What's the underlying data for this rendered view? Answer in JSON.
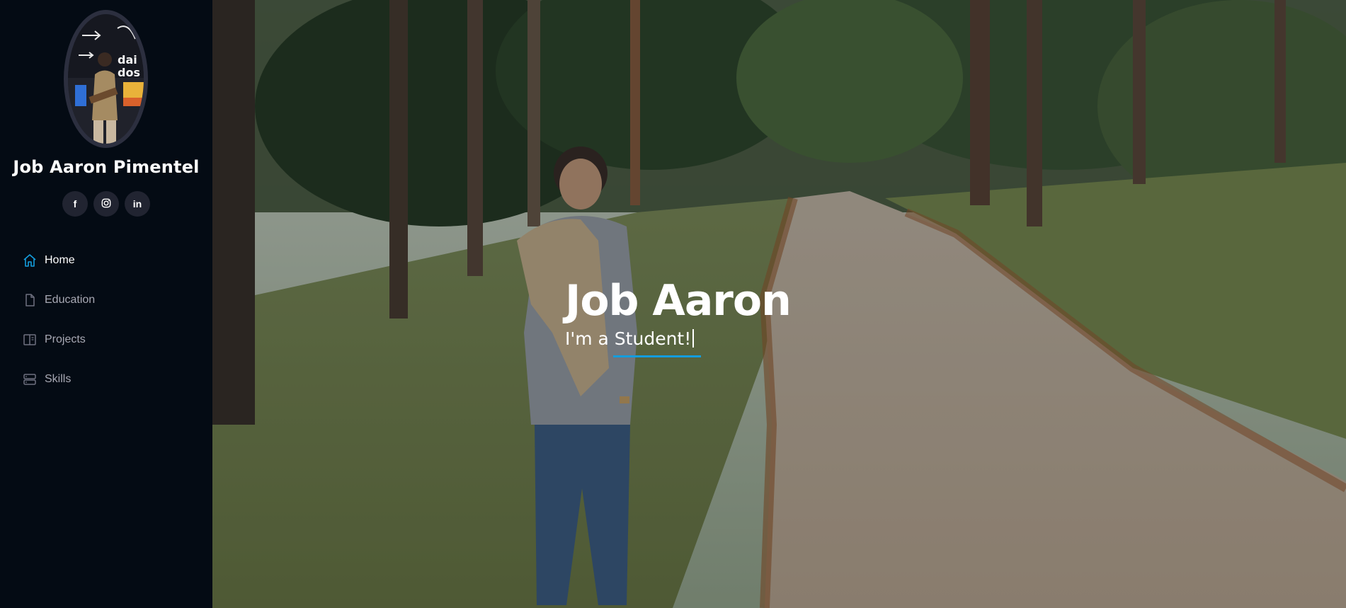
{
  "profile": {
    "name": "Job Aaron Pimentel",
    "avatar_alt": "avatar"
  },
  "social": {
    "facebook_label": "f",
    "instagram_label": "◎",
    "linkedin_label": "in"
  },
  "nav": {
    "items": [
      {
        "label": "Home",
        "icon": "home-icon",
        "active": true
      },
      {
        "label": "Education",
        "icon": "file-icon",
        "active": false
      },
      {
        "label": "Projects",
        "icon": "book-icon",
        "active": false
      },
      {
        "label": "Skills",
        "icon": "server-icon",
        "active": false
      }
    ]
  },
  "hero": {
    "title": "Job Aaron",
    "subtitle": "I'm a Student!"
  },
  "colors": {
    "sidebar_bg": "#040b14",
    "accent": "#149ddd",
    "social_bg": "#212431",
    "nav_text": "#a8a9b4"
  }
}
